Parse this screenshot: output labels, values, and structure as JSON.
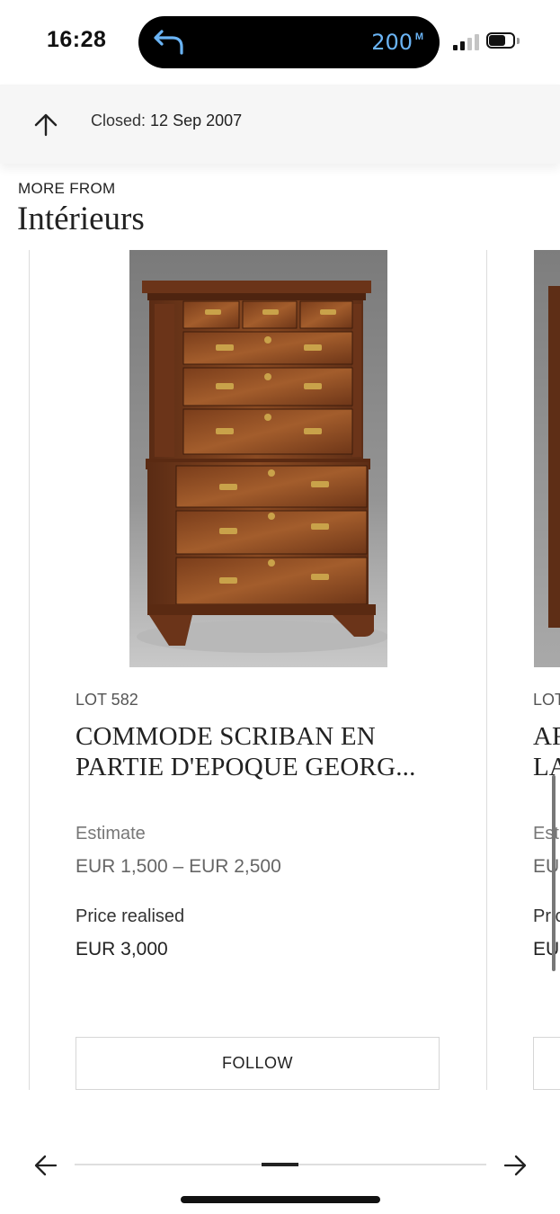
{
  "status": {
    "time": "16:28",
    "island_value": "200",
    "island_unit": "M"
  },
  "header": {
    "closed_label": "Closed:",
    "closed_date": "12 Sep 2007"
  },
  "section": {
    "eyebrow": "MORE FROM",
    "title": "Intérieurs"
  },
  "card": {
    "lot": "LOT 582",
    "title": "COMMODE SCRIBAN EN PARTIE D'EPOQUE GEORG...",
    "estimate_label": "Estimate",
    "estimate_value": "EUR 1,500 – EUR 2,500",
    "price_label": "Price realised",
    "price_value": "EUR 3,000",
    "follow_label": "FOLLOW"
  },
  "next_card": {
    "lot": "LOT",
    "title_line1": "AR",
    "title_line2": "LA",
    "estimate_label": "Est",
    "estimate_value": "EU",
    "price_label": "Pric",
    "price_value": "EU"
  },
  "icons": [
    "back-arrow-icon",
    "signal-icon",
    "battery-icon",
    "up-arrow-icon",
    "arrow-left-icon",
    "arrow-right-icon"
  ]
}
